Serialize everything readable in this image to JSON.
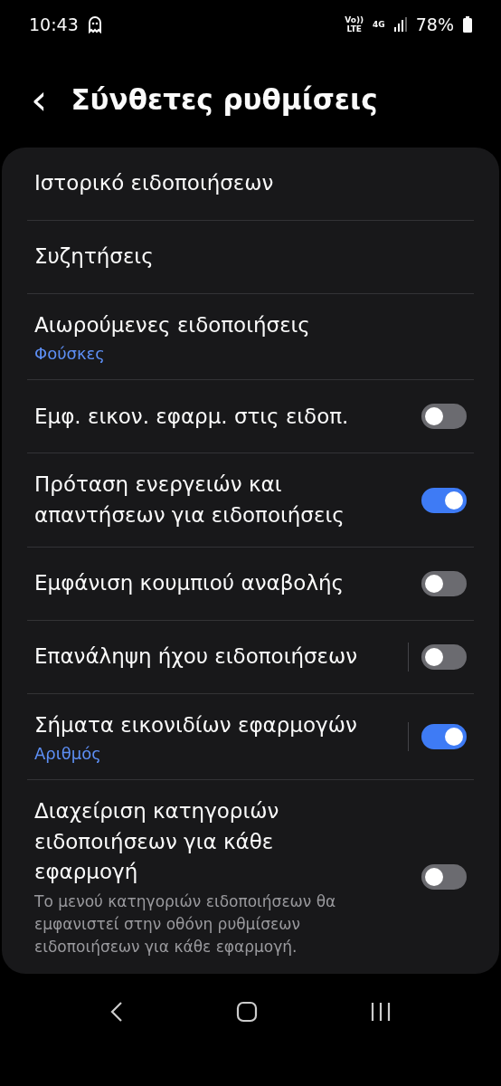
{
  "status_bar": {
    "time": "10:43",
    "volte": "Vo))",
    "lte": "LTE",
    "network": "4G",
    "battery": "78%"
  },
  "header": {
    "back": "‹",
    "title": "Σύνθετες ρυθμίσεις"
  },
  "items": [
    {
      "kind": "link",
      "title": "Ιστορικό ειδοποιήσεων"
    },
    {
      "kind": "link",
      "title": "Συζητήσεις"
    },
    {
      "kind": "link",
      "title": "Αιωρούμενες ειδοποιήσεις",
      "value": "Φούσκες"
    },
    {
      "kind": "toggle",
      "title": "Εμφ. εικον. εφαρμ. στις ειδοπ.",
      "on": false,
      "split": false
    },
    {
      "kind": "toggle",
      "title": "Πρόταση ενεργειών και απαντήσεων για ειδοποιήσεις",
      "on": true,
      "split": false
    },
    {
      "kind": "toggle",
      "title": "Εμφάνιση κουμπιού αναβολής",
      "on": false,
      "split": false
    },
    {
      "kind": "toggle",
      "title": "Επανάληψη ήχου ειδοποιήσεων",
      "on": false,
      "split": true
    },
    {
      "kind": "toggle",
      "title": "Σήματα εικονιδίων εφαρμογών",
      "value": "Αριθμός",
      "on": true,
      "split": true
    },
    {
      "kind": "toggle",
      "title": "Διαχείριση κατηγοριών ειδοποιήσεων για κάθε εφαρμογή",
      "description": "Το μενού κατηγοριών ειδοποιήσεων θα εμφανιστεί στην οθόνη ρυθμίσεων ειδοποιήσεων για κάθε εφαρμογή.",
      "on": false,
      "split": false
    }
  ]
}
